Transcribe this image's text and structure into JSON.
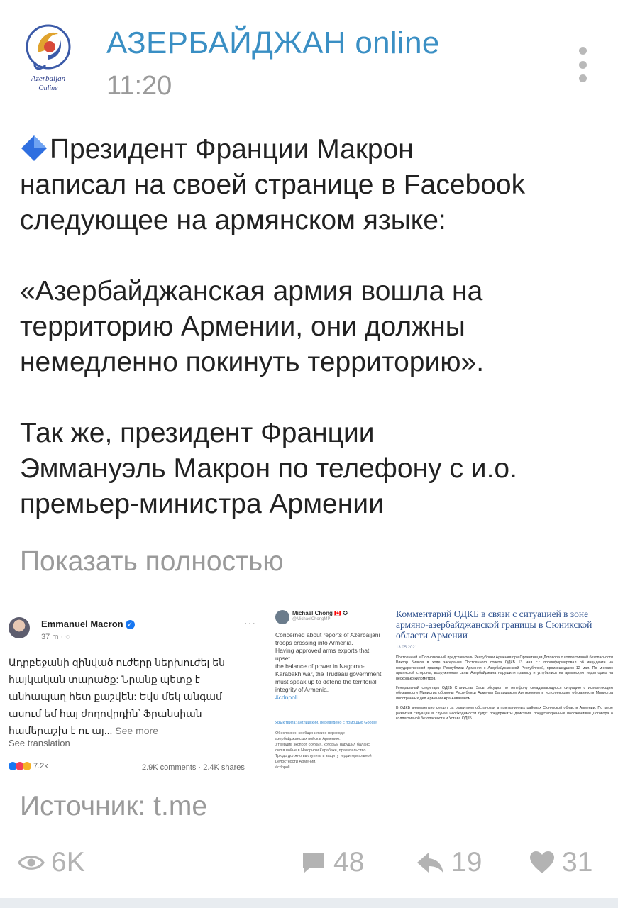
{
  "channel": {
    "title": "АЗЕРБАЙДЖАН online",
    "time": "11:20",
    "logo_text_line1": "Azerbaijan",
    "logo_text_line2": "Online"
  },
  "post": {
    "paragraphs": [
      "Президент Франции Макрон\nнаписал на своей странице в Facebook\nследующее на армянском языке:",
      " «Азербайджанская армия вошла на\nтерриторию Армении, они должны\nнемедленно покинуть территорию».",
      "Так же, президент Франции\nЭммануэль Макрон по телефону с и.о.\nпремьер-министра Армении"
    ],
    "show_more": "Показать полностью",
    "source": "Источник: t.me"
  },
  "media": {
    "facebook": {
      "name": "Emmanuel Macron",
      "meta": "37 m · ",
      "more": "···",
      "text": "Ադրբեջանի զինված ուժերը ներխուժել են\nհայկական տարածք: Նրանք պետք է\nանհապաղ հետ քաշվեն: Եվս մեկ անգամ\nասում եմ հայ ժողովրդին՝ Ֆրանսիան\nհամերաշխ է ու այ...",
      "see_more": " See more",
      "see_translation": "See translation",
      "reactions": "7.2k",
      "stats": "2.9K comments · 2.4K shares"
    },
    "twitter": {
      "name": "Michael Chong 🇨🇦 ✪",
      "handle": "@MichaelChongMP",
      "text": "Concerned about reports of Azerbaijani\ntroops crossing into Armenia.\nHaving approved arms exports that upset\nthe balance of power in Nagorno-\nKarabakh war, the Trudeau government\nmust speak up to defend the territorial\nintegrity of Armenia.",
      "hashtag": "#cdnpoli",
      "translated_label": "Язык твита: английский, переведено с помощью Google",
      "translated_text": "Обеспокоен сообщениями о переходе\nазербайджанских войск в Армению.\nУтвердив экспорт оружия, который нарушил баланс\nсил в войне в Нагорном Карабахе, правительство\nТрюдо должно выступить в защиту территориальной\nцелостности Армении.\n#cdnpoli"
    },
    "csto": {
      "title": "Комментарий ОДКБ в связи с ситуацией в зоне армяно-азербайджанской границы в Сюникской области Армении",
      "date": "13.05.2021",
      "paragraphs": [
        "Постоянный и Полномочный представитель Республики Армения при Организации Договора о коллективной безопасности Виктор Бияков в ходе заседания Постоянного совета ОДКБ 13 мая с.г. проинформировал об инциденте на государственной границе Республики Армения с Азербайджанской Республикой, произошедшем 12 мая. По мнению армянской стороны, вооруженные силы Азербайджана нарушили границу и углубились на армянскую территорию на несколько километров.",
        "Генеральный секретарь ОДКБ Станислав Зась обсудил по телефону складывающуюся ситуацию с исполняющим обязанности Министра обороны Республики Армения Вагаршаком Арутюняном и исполняющим обязанности Министра иностранных дел Армении Ара Айвазяном.",
        "В ОДКБ внимательно следят за развитием обстановки в приграничных районах Сюникской области Армении. По мере развития ситуации в случае необходимости будут предприняты действия, предусмотренные положениями Договора о коллективной безопасности и Устава ОДКБ."
      ]
    }
  },
  "footer": {
    "views": "6K",
    "comments": "48",
    "shares": "19",
    "likes": "31"
  },
  "colors": {
    "accent": "#3a8fc4",
    "muted": "#9a9a9a",
    "icon": "#b3b3b3",
    "diamond": "#2f6fe0"
  }
}
